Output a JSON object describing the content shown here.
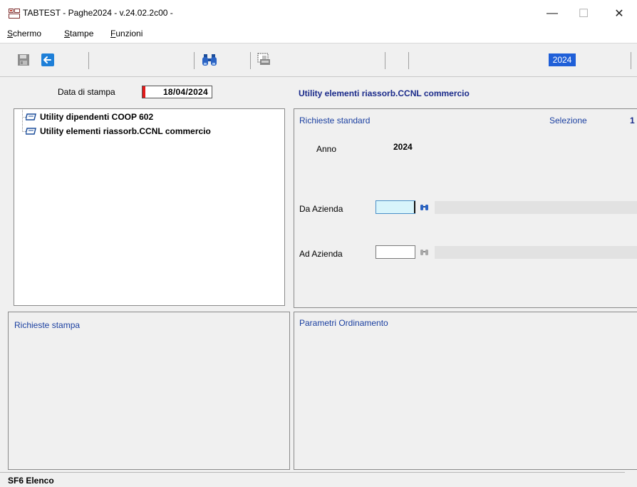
{
  "window": {
    "title": "TABTEST - Paghe2024 - v.24.02.2c00 -",
    "min_label": "—",
    "max_label": "☐",
    "close_label": "✕"
  },
  "menu": [
    {
      "first": "S",
      "rest": "chermo"
    },
    {
      "first": "S",
      "rest": "tampe"
    },
    {
      "first": "F",
      "rest": "unzioni"
    }
  ],
  "toolbar": {
    "year": "2024",
    "icons": [
      "save-icon",
      "back-arrow-icon",
      "binoculars-icon",
      "print-preview-icon"
    ],
    "accent": "#1f5fd8"
  },
  "header": {
    "date_label": "Data di stampa",
    "date_value": "18/04/2024",
    "utility_title": "Utility elementi riassorb.CCNL commercio"
  },
  "tree": {
    "items": [
      {
        "label": "Utility dipendenti COOP 602"
      },
      {
        "label": "Utility elementi riassorb.CCNL commercio"
      }
    ]
  },
  "standard": {
    "title": "Richieste standard",
    "selection_label": "Selezione",
    "selection_value": "1",
    "anno_label": "Anno",
    "anno_value": "2024",
    "da_azienda_label": "Da Azienda",
    "da_azienda_value": "",
    "ad_azienda_label": "Ad Azienda",
    "ad_azienda_value": ""
  },
  "stampa": {
    "title": "Richieste stampa"
  },
  "ordinamento": {
    "title": "Parametri Ordinamento"
  },
  "status": {
    "text": "SF6 Elenco"
  }
}
